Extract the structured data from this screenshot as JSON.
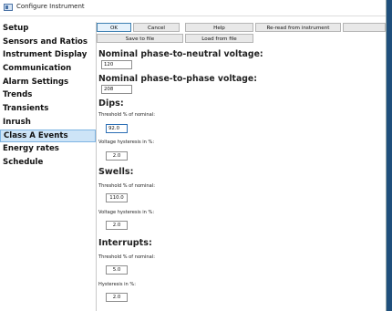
{
  "window": {
    "title": "Configure Instrument"
  },
  "sidebar": {
    "items": [
      {
        "label": "Setup"
      },
      {
        "label": "Sensors and Ratios"
      },
      {
        "label": "Instrument Display"
      },
      {
        "label": "Communication"
      },
      {
        "label": "Alarm Settings"
      },
      {
        "label": "Trends"
      },
      {
        "label": "Transients"
      },
      {
        "label": "Inrush"
      },
      {
        "label": "Class A Events",
        "selected": true
      },
      {
        "label": "Energy rates"
      },
      {
        "label": "Schedule"
      }
    ]
  },
  "toolbar": {
    "ok": "OK",
    "cancel": "Cancel",
    "help": "Help",
    "reread": "Re-read from instrument",
    "save_file": "Save to file",
    "load_file": "Load from file"
  },
  "nominal": {
    "phase_neutral_label": "Nominal phase-to-neutral voltage:",
    "phase_neutral_value": "120",
    "phase_phase_label": "Nominal phase-to-phase voltage:",
    "phase_phase_value": "208"
  },
  "dips": {
    "title": "Dips:",
    "threshold_label": "Threshold % of nominal:",
    "threshold_value": "92.0",
    "hysteresis_label": "Voltage hysteresis in %:",
    "hysteresis_value": "2.0"
  },
  "swells": {
    "title": "Swells:",
    "threshold_label": "Threshold % of nominal:",
    "threshold_value": "110.0",
    "hysteresis_label": "Voltage hysteresis in %:",
    "hysteresis_value": "2.0"
  },
  "interrupts": {
    "title": "Interrupts:",
    "threshold_label": "Threshold % of nominal:",
    "threshold_value": "5.0",
    "hysteresis_label": "Hysteresis in %:",
    "hysteresis_value": "2.0"
  }
}
